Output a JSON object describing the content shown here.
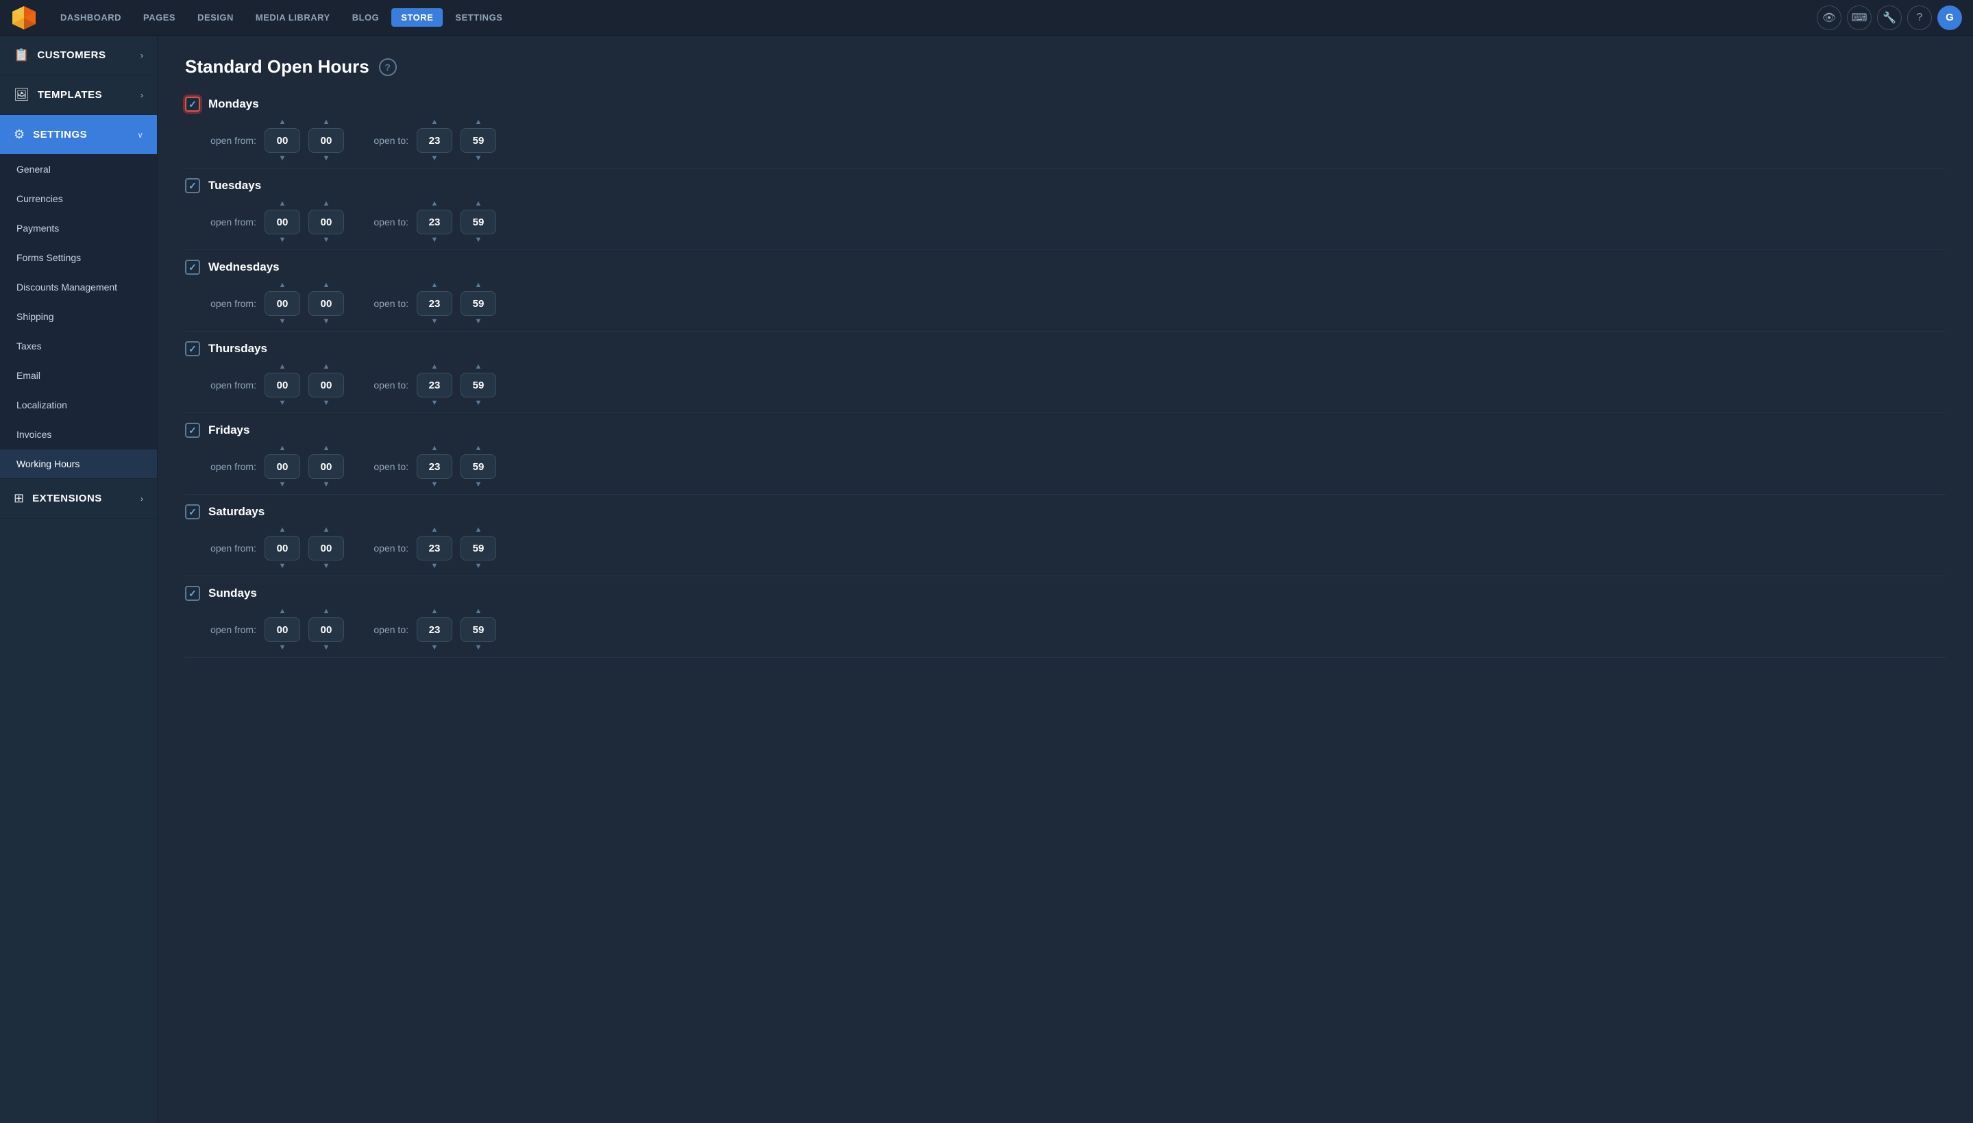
{
  "nav": {
    "links": [
      {
        "label": "DASHBOARD",
        "active": false
      },
      {
        "label": "PAGES",
        "active": false
      },
      {
        "label": "DESIGN",
        "active": false
      },
      {
        "label": "MEDIA LIBRARY",
        "active": false
      },
      {
        "label": "BLOG",
        "active": false
      },
      {
        "label": "STORE",
        "active": true
      },
      {
        "label": "SETTINGS",
        "active": false
      }
    ],
    "icons": [
      "👁",
      "⌨",
      "🔧",
      "?"
    ],
    "avatar_label": "G"
  },
  "sidebar": {
    "items": [
      {
        "id": "customers",
        "icon": "📋",
        "label": "CUSTOMERS",
        "active": false,
        "has_chevron": true
      },
      {
        "id": "templates",
        "icon": "🖼",
        "label": "TEMPLATES",
        "active": false,
        "has_chevron": true
      },
      {
        "id": "settings",
        "icon": "⚙",
        "label": "SETTINGS",
        "active": true,
        "has_chevron": true
      },
      {
        "id": "extensions",
        "icon": "⊞",
        "label": "EXTENSIONS",
        "active": false,
        "has_chevron": true
      }
    ],
    "settings_submenu": [
      "General",
      "Currencies",
      "Payments",
      "Forms Settings",
      "Discounts Management",
      "Shipping",
      "Taxes",
      "Email",
      "Localization",
      "Invoices",
      "Working Hours"
    ]
  },
  "content": {
    "title": "Standard Open Hours",
    "days": [
      {
        "id": "mondays",
        "name": "Mondays",
        "checked": true,
        "highlighted": true,
        "open_from_h": "00",
        "open_from_m": "00",
        "open_to_h": "23",
        "open_to_m": "59"
      },
      {
        "id": "tuesdays",
        "name": "Tuesdays",
        "checked": true,
        "highlighted": false,
        "open_from_h": "00",
        "open_from_m": "00",
        "open_to_h": "23",
        "open_to_m": "59"
      },
      {
        "id": "wednesdays",
        "name": "Wednesdays",
        "checked": true,
        "highlighted": false,
        "open_from_h": "00",
        "open_from_m": "00",
        "open_to_h": "23",
        "open_to_m": "59"
      },
      {
        "id": "thursdays",
        "name": "Thursdays",
        "checked": true,
        "highlighted": false,
        "open_from_h": "00",
        "open_from_m": "00",
        "open_to_h": "23",
        "open_to_m": "59"
      },
      {
        "id": "fridays",
        "name": "Fridays",
        "checked": true,
        "highlighted": false,
        "open_from_h": "00",
        "open_from_m": "00",
        "open_to_h": "23",
        "open_to_m": "59"
      },
      {
        "id": "saturdays",
        "name": "Saturdays",
        "checked": true,
        "highlighted": false,
        "open_from_h": "00",
        "open_from_m": "00",
        "open_to_h": "23",
        "open_to_m": "59"
      },
      {
        "id": "sundays",
        "name": "Sundays",
        "checked": true,
        "highlighted": false,
        "open_from_h": "00",
        "open_from_m": "00",
        "open_to_h": "23",
        "open_to_m": "59"
      }
    ],
    "labels": {
      "open_from": "open from:",
      "open_to": "open to:"
    }
  }
}
